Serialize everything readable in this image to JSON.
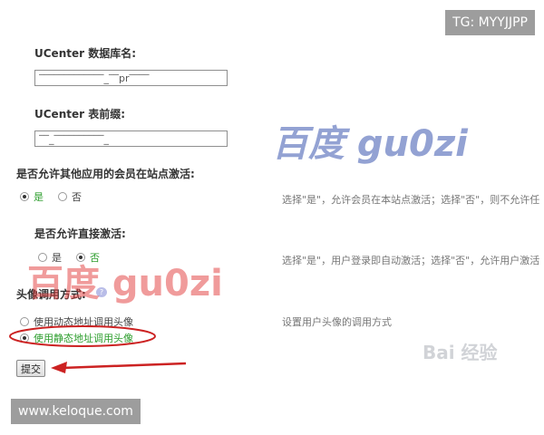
{
  "fields": {
    "db_name": {
      "label": "UCenter 数据库名:",
      "value": "‾‾‾‾‾‾‾‾‾‾‾‾‾_‾‾pr‾‾‾‾"
    },
    "table_prefix": {
      "label": "UCenter 表前缀:",
      "value": "‾‾_‾‾‾‾‾‾‾‾‾‾_"
    }
  },
  "allow_other_app_activate": {
    "label": "是否允许其他应用的会员在站点激活:",
    "options": [
      "是",
      "否"
    ],
    "selected": "是",
    "hint": "选择\"是\"，允许会员在本站点激活；选择\"否\"，则不允许任"
  },
  "allow_direct_activate": {
    "label": "是否允许直接激活:",
    "options": [
      "是",
      "否"
    ],
    "selected": "否",
    "hint": "选择\"是\"，用户登录即自动激活；选择\"否\"，允许用户激活"
  },
  "avatar_mode": {
    "label": "头像调用方式:",
    "options": [
      "使用动态地址调用头像",
      "使用静态地址调用头像"
    ],
    "selected": "使用静态地址调用头像",
    "hint": "设置用户头像的调用方式"
  },
  "submit_label": "提交",
  "watermarks": {
    "top_right": "TG: MYYJJPP",
    "bottom_left": "www.keloque.com",
    "baidu_blue": "百度 gu0zi",
    "baidu_red": "百度 gu0zi",
    "baidu_jingyan": "Bai 经验"
  },
  "colors": {
    "green_text": "#2c9d2c",
    "annotation_red": "#cc2222",
    "watermark_blue": "#2a47a8",
    "watermark_red": "#e23a3a"
  }
}
